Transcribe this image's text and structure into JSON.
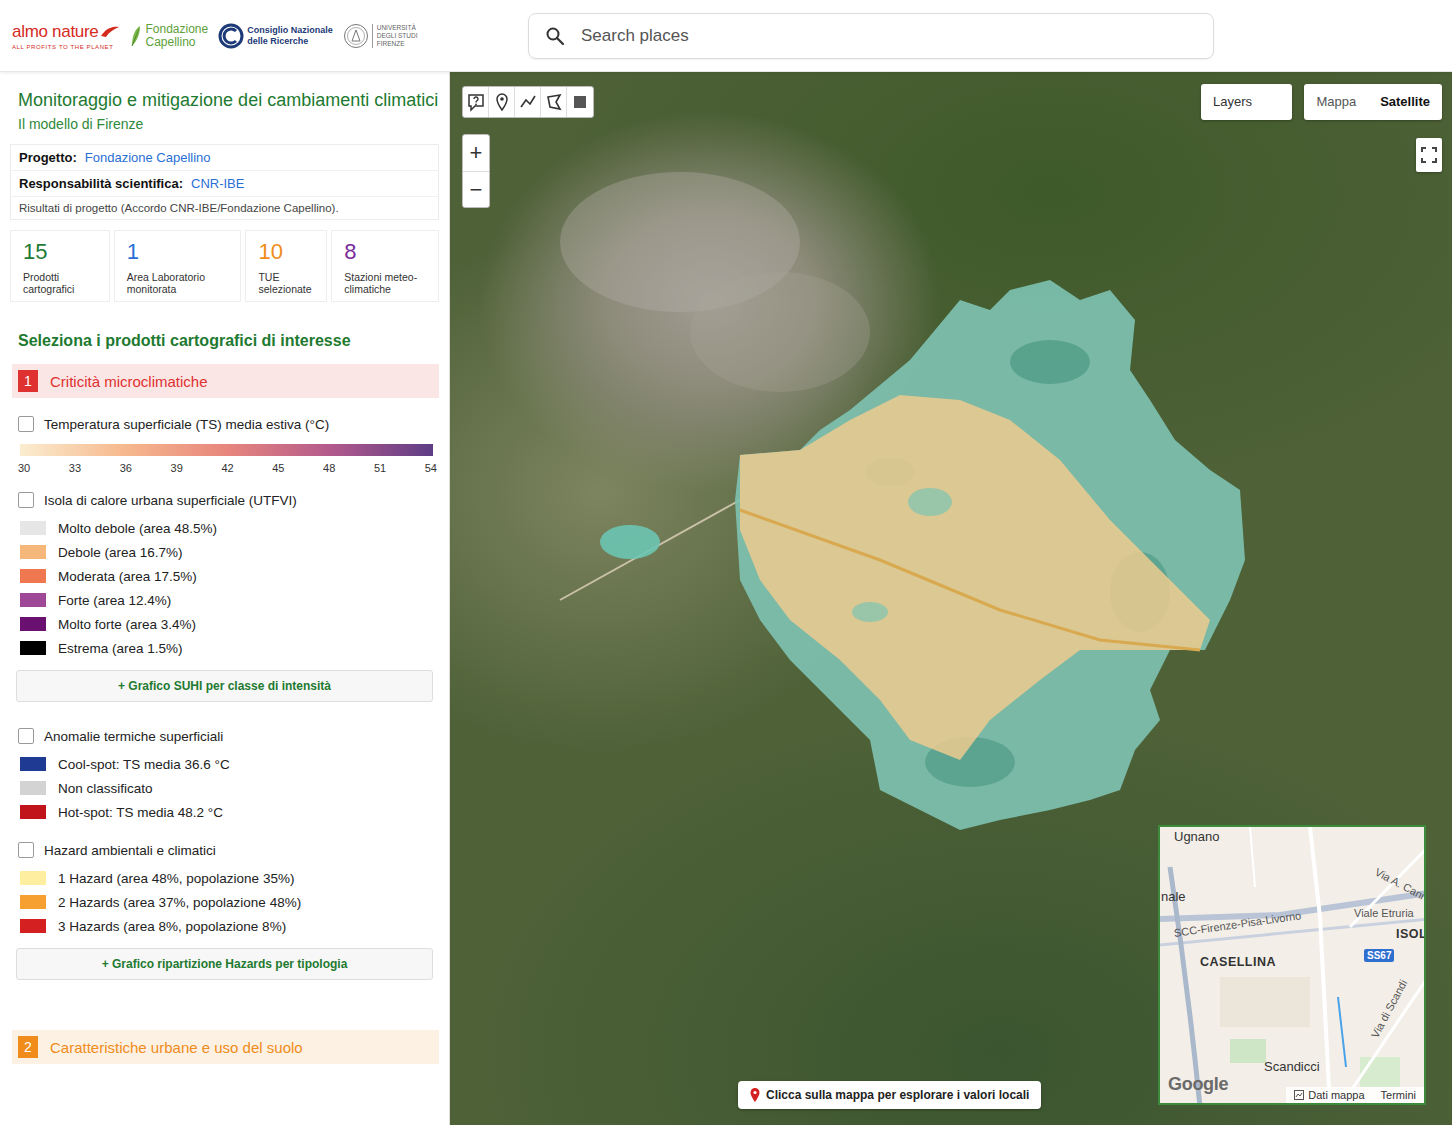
{
  "header": {
    "logos": {
      "almo": {
        "name": "almo nature",
        "tagline": "ALL PROFITS TO THE PLANET"
      },
      "capellino": [
        "Fondazione",
        "Capellino"
      ],
      "cnr": [
        "Consiglio Nazionale",
        "delle Ricerche"
      ],
      "unifi": [
        "UNIVERSITÀ",
        "DEGLI STUDI",
        "FIRENZE"
      ]
    },
    "search": {
      "placeholder": "Search places"
    }
  },
  "panel": {
    "title": "Monitoraggio e mitigazione dei cambiamenti climatici",
    "subtitle": "Il modello di Firenze",
    "info": [
      {
        "label": "Progetto:",
        "value": "Fondazione Capellino"
      },
      {
        "label": "Responsabilità scientifica:",
        "value": "CNR-IBE"
      }
    ],
    "note": "Risultati di progetto (Accordo CNR-IBE/Fondazione Capellino).",
    "stats": [
      {
        "value": "15",
        "label": "Prodotti cartografici",
        "color": "#1e7b34"
      },
      {
        "value": "1",
        "label": "Area Laboratorio monitorata",
        "color": "#2a6fd6"
      },
      {
        "value": "10",
        "label": "TUE selezionate",
        "color": "#f08c1a"
      },
      {
        "value": "8",
        "label": "Stazioni meteo-climatiche",
        "color": "#7b2c9a"
      }
    ],
    "heading": "Seleziona i prodotti cartografici di interesse",
    "sections": [
      {
        "number": "1",
        "title": "Criticità microclimatiche",
        "color": "#e03131",
        "layers": [
          {
            "kind": "gradient",
            "label": "Temperatura superficiale (TS) media estiva (°C)",
            "checked": false,
            "colors": [
              "#fbedd0",
              "#f6b98e",
              "#e8867d",
              "#b35a8c",
              "#5e3d85"
            ],
            "ticks": [
              "30",
              "33",
              "36",
              "39",
              "42",
              "45",
              "48",
              "51",
              "54"
            ]
          },
          {
            "kind": "legend",
            "label": "Isola di calore urbana superficiale (UTFVI)",
            "checked": false,
            "items": [
              {
                "label": "Molto debole (area 48.5%)",
                "color": "#e6e6e6"
              },
              {
                "label": "Debole (area 16.7%)",
                "color": "#f5b87a"
              },
              {
                "label": "Moderata (area 17.5%)",
                "color": "#f07850"
              },
              {
                "label": "Forte (area 12.4%)",
                "color": "#a04898"
              },
              {
                "label": "Molto forte (area 3.4%)",
                "color": "#6a1070"
              },
              {
                "label": "Estrema (area 1.5%)",
                "color": "#000000"
              }
            ],
            "button": "+ Grafico SUHI per classe di intensità"
          },
          {
            "kind": "legend",
            "label": "Anomalie termiche superficiali",
            "checked": false,
            "items": [
              {
                "label": "Cool-spot: TS media 36.6 °C",
                "color": "#1f3a93"
              },
              {
                "label": "Non classificato",
                "color": "#d3d3d3"
              },
              {
                "label": "Hot-spot: TS media 48.2 °C",
                "color": "#c0141a"
              }
            ]
          },
          {
            "kind": "legend",
            "label": "Hazard ambientali e climatici",
            "checked": false,
            "items": [
              {
                "label": "1 Hazard (area 48%, popolazione 35%)",
                "color": "#fdeea0"
              },
              {
                "label": "2 Hazards (area 37%, popolazione 48%)",
                "color": "#f5a030"
              },
              {
                "label": "3 Hazards (area 8%, popolazione 8%)",
                "color": "#d42020"
              }
            ],
            "button": "+ Grafico ripartizione Hazards per tipologia"
          }
        ]
      },
      {
        "number": "2",
        "title": "Caratteristiche urbane e uso del suolo",
        "color": "#f08c1a",
        "layers": []
      }
    ]
  },
  "map": {
    "zoom": {
      "in": "+",
      "out": "−"
    },
    "layers_button": "Layers",
    "map_types": [
      {
        "label": "Mappa",
        "selected": false
      },
      {
        "label": "Satellite",
        "selected": true
      }
    ],
    "hint": "Clicca sulla mappa per esplorare i valori locali",
    "inset": {
      "labels": [
        {
          "text": "Ugnano",
          "kind": "place"
        },
        {
          "text": "nale",
          "kind": "place"
        },
        {
          "text": "Via A. Cani",
          "kind": "road"
        },
        {
          "text": "Viale Etruria",
          "kind": "road"
        },
        {
          "text": "ISOL",
          "kind": "district"
        },
        {
          "text": "SCC-Firenze-Pisa-Livorno",
          "kind": "road"
        },
        {
          "text": "CASELLINA",
          "kind": "district"
        },
        {
          "text": "SS67",
          "kind": "shield"
        },
        {
          "text": "Scandicci",
          "kind": "place"
        },
        {
          "text": "Via di Scandi",
          "kind": "road"
        }
      ],
      "logo": "Google",
      "links": [
        "Dati mappa",
        "Termini"
      ]
    }
  }
}
